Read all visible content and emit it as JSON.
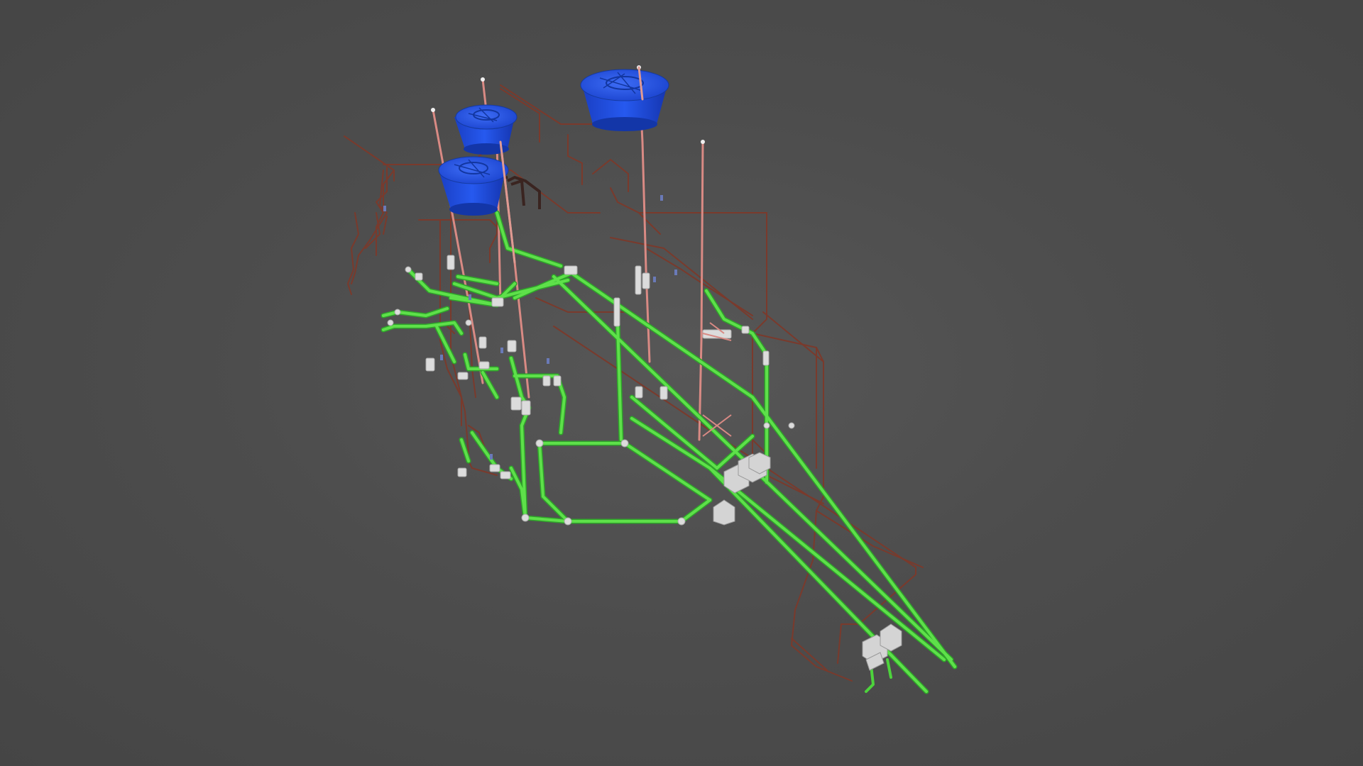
{
  "viewer": {
    "background": "#4d4d4d",
    "colors": {
      "water_tank": "#1646d6",
      "water_tank_highlight": "#3a6af0",
      "drain_pipe": "#4dd33c",
      "drain_pipe_highlight": "#86f06e",
      "supply_pipe": "#7a3a2c",
      "vent_pipe": "#d98a84",
      "fitting": "#d9d9d9"
    },
    "objects": [
      {
        "name": "water-tank",
        "count": 3
      },
      {
        "name": "drain-pipe-network"
      },
      {
        "name": "cold-water-supply-network"
      },
      {
        "name": "vent-stacks"
      },
      {
        "name": "inspection-boxes"
      }
    ]
  }
}
